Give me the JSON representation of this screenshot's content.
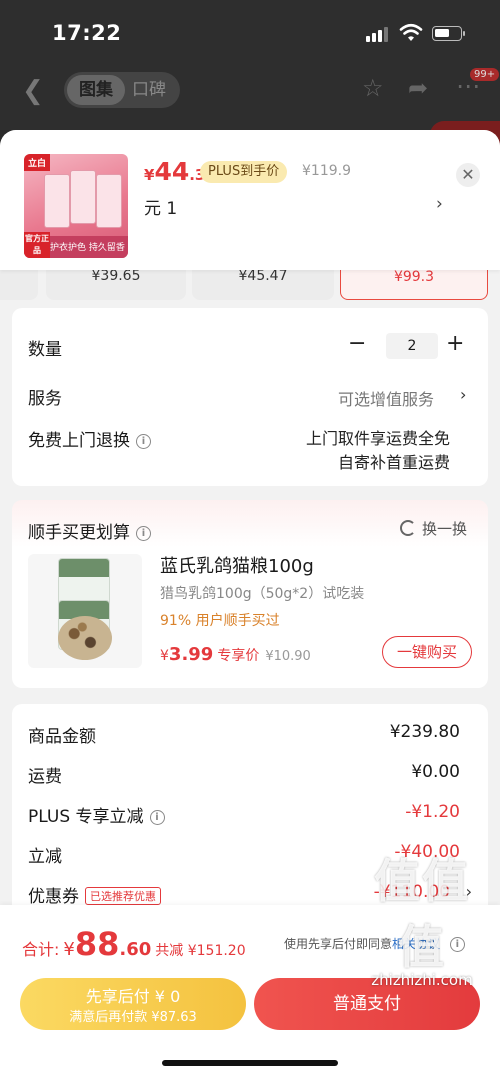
{
  "status_bar": {
    "time": "17:22"
  },
  "top_nav": {
    "tab_gallery": "图集",
    "tab_reviews": "口碑",
    "badge": "99+"
  },
  "product": {
    "thumb_tag": "立白",
    "thumb_promo": "护衣护色 持久留香",
    "thumb_official": "官方正品",
    "price_currency": "¥",
    "price_int": "44",
    "price_dec": ".3",
    "plus_tag": "PLUS到手价",
    "original_price": "¥119.9",
    "spec": "元  1"
  },
  "spec_options": [
    "¥39.65",
    "¥45.47",
    "¥99.3"
  ],
  "order_card": {
    "qty_label": "数量",
    "qty_value": "2",
    "service_label": "服务",
    "service_value": "可选增值服务",
    "return_label": "免费上门退换",
    "return_line1": "上门取件享运费全免",
    "return_line2": "自寄补首重运费"
  },
  "addon": {
    "title": "顺手买更划算",
    "swap_label": "换一换",
    "name": "蓝氏乳鸽猫粮100g",
    "desc": "猎鸟乳鸽100g（50g*2）试吃装",
    "stat": "91% 用户顺手买过",
    "price_currency": "¥",
    "price_value": "3.99",
    "price_label": "专享价",
    "old_price": "¥10.90",
    "buy_label": "一键购买"
  },
  "summary": {
    "rows": [
      {
        "label": "商品金额",
        "value": "¥239.80"
      },
      {
        "label": "运费",
        "value": "¥0.00"
      },
      {
        "label": "PLUS 专享立减",
        "value": "-¥1.20"
      },
      {
        "label": "立减",
        "value": "-¥40.00"
      },
      {
        "label": "优惠券",
        "value": "-¥110.00",
        "tag": "已选推荐优惠"
      }
    ]
  },
  "bottom": {
    "total_label": "合计:",
    "total_currency": "¥",
    "total_int": "88",
    "total_dec": ".60",
    "saved": "共减 ¥151.20",
    "agree_text": "使用先享后付即同意",
    "agree_link": "相关协议",
    "later_title": "先享后付 ¥ 0",
    "later_sub": "满意后再付款 ¥87.63",
    "pay_label": "普通支付"
  },
  "watermark": {
    "logo": "值值值",
    "site": "zhizhizhi.com"
  },
  "colors": {
    "accent_red": "#e4393c",
    "plus_gold": "#faeab0",
    "later_yellow": "#f4c23f",
    "link_blue": "#2a6ec6"
  }
}
